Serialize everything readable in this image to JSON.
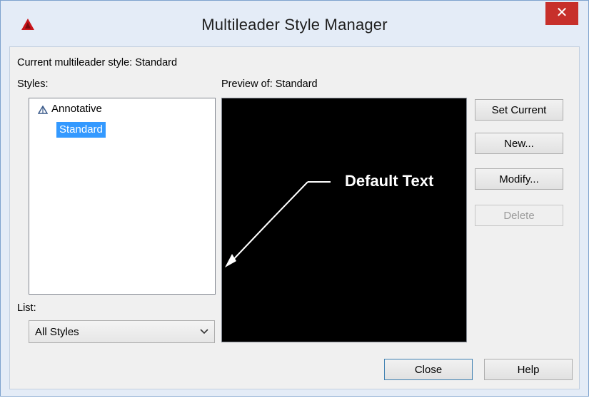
{
  "window": {
    "title": "Multileader Style Manager",
    "close_glyph": "✕",
    "app_icon": "autocad-icon"
  },
  "current_style": {
    "label": "Current multileader style: Standard"
  },
  "styles": {
    "label": "Styles:",
    "items": [
      {
        "label": "Annotative",
        "icon": "annotative-icon",
        "selected": false
      },
      {
        "label": "Standard",
        "selected": true
      }
    ]
  },
  "preview": {
    "label": "Preview of: Standard",
    "sample_text": "Default Text",
    "background": "#000000",
    "foreground": "#ffffff"
  },
  "buttons": {
    "set_current": "Set Current",
    "new": "New...",
    "modify": "Modify...",
    "delete": "Delete",
    "close": "Close",
    "help": "Help"
  },
  "list_filter": {
    "label": "List:",
    "value": "All Styles"
  },
  "colors": {
    "selection": "#3399ff",
    "close_button": "#c7302b",
    "frame": "#e4ecf7"
  }
}
